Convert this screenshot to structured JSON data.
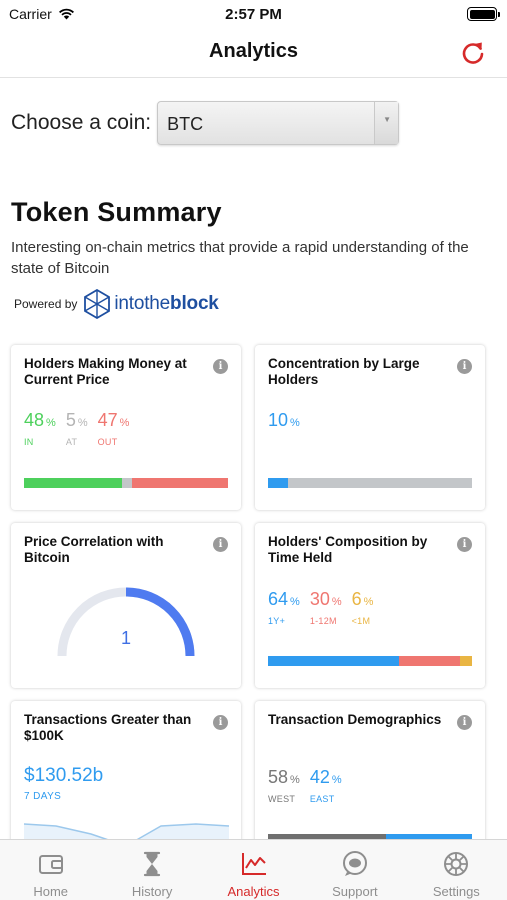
{
  "status_bar": {
    "carrier": "Carrier",
    "time": "2:57 PM"
  },
  "nav": {
    "title": "Analytics"
  },
  "coin_selector": {
    "label": "Choose a coin:",
    "value": "BTC"
  },
  "summary": {
    "title": "Token Summary",
    "description": "Interesting on-chain metrics that provide a rapid understanding of the state of Bitcoin",
    "powered_by": "Powered by",
    "brand_into": "into",
    "brand_the": "the",
    "brand_block": "block"
  },
  "cards": {
    "holders_money": {
      "title": "Holders Making Money at Current Price",
      "in_value": "48",
      "in_label": "IN",
      "at_value": "5",
      "at_label": "AT",
      "out_value": "47",
      "out_label": "OUT",
      "pct": "%",
      "bar": [
        0.48,
        0.05,
        0.47
      ]
    },
    "concentration": {
      "title": "Concentration by Large Holders",
      "value": "10",
      "pct": "%",
      "bar": [
        0.1,
        0.9
      ]
    },
    "correlation": {
      "title": "Price Correlation with Bitcoin",
      "value": "1",
      "gauge_fraction": 1
    },
    "composition": {
      "title": "Holders' Composition by Time Held",
      "long_value": "64",
      "long_label": "1Y+",
      "mid_value": "30",
      "mid_label": "1-12M",
      "short_value": "6",
      "short_label": "<1M",
      "pct": "%",
      "bar": [
        0.64,
        0.3,
        0.06
      ]
    },
    "large_tx": {
      "title": "Transactions Greater than $100K",
      "value": "$130.52b",
      "period": "7 DAYS"
    },
    "demographics": {
      "title": "Transaction Demographics",
      "west_value": "58",
      "west_label": "WEST",
      "east_value": "42",
      "east_label": "EAST",
      "pct": "%",
      "bar": [
        0.58,
        0.42
      ]
    }
  },
  "tabs": [
    {
      "label": "Home",
      "icon": "wallet-icon"
    },
    {
      "label": "History",
      "icon": "hourglass-icon"
    },
    {
      "label": "Analytics",
      "icon": "chart-icon",
      "active": true
    },
    {
      "label": "Support",
      "icon": "chat-bubble-icon"
    },
    {
      "label": "Settings",
      "icon": "gear-icon"
    }
  ],
  "colors": {
    "accent": "#d62a2a",
    "green": "#4dd05c",
    "red": "#ef7670",
    "blue": "#2f9bef",
    "grey": "#c3c6c9",
    "orange": "#e9b543",
    "brand": "#1e4fa0"
  }
}
